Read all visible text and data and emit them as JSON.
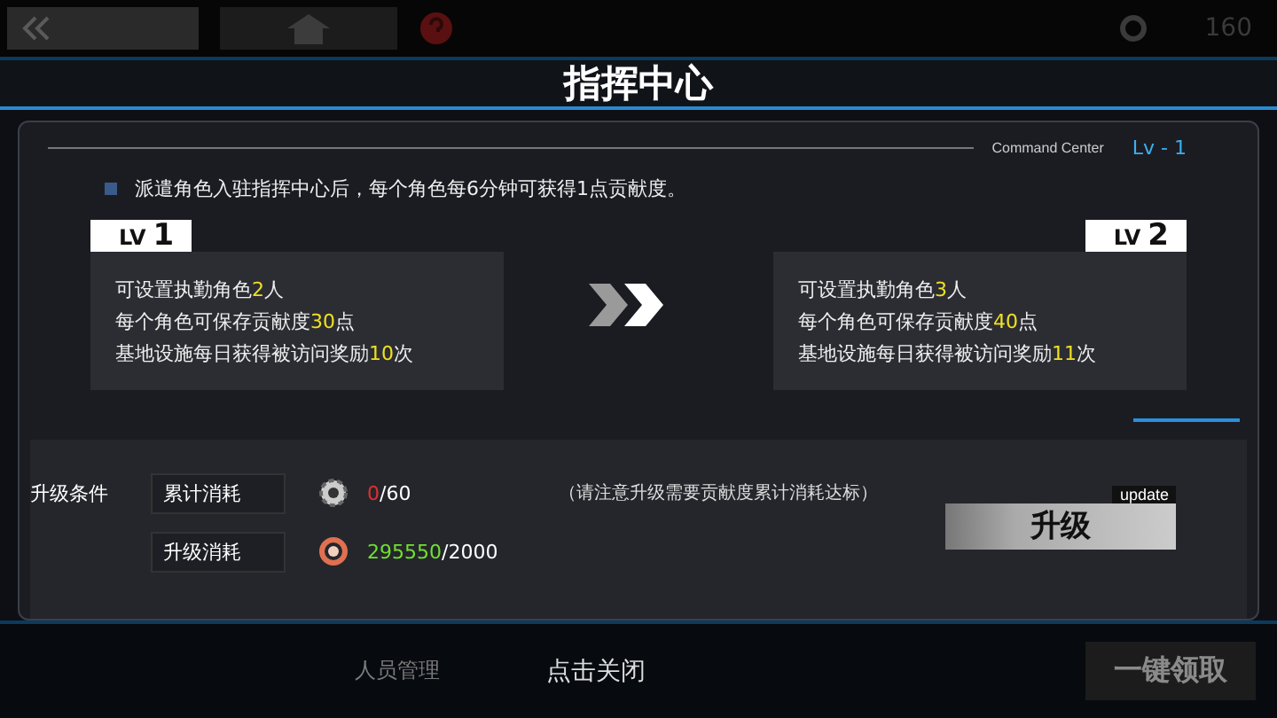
{
  "background": {
    "counter": "160",
    "tab": "人员管理",
    "claim_button": "一键领取"
  },
  "title": "指挥中心",
  "panel": {
    "subtitle": "Command Center",
    "level": "Lv - 1",
    "note": "派遣角色入驻指挥中心后，每个角色每6分钟可获得1点贡献度。",
    "cards": [
      {
        "tag": "LV",
        "level": "1",
        "lines": [
          {
            "before": "可设置执勤角色",
            "value": "2",
            "after": "人"
          },
          {
            "before": "每个角色可保存贡献度",
            "value": "30",
            "after": "点"
          },
          {
            "before": "基地设施每日获得被访问奖励",
            "value": "10",
            "after": "次"
          }
        ]
      },
      {
        "tag": "LV",
        "level": "2",
        "lines": [
          {
            "before": "可设置执勤角色",
            "value": "3",
            "after": "人"
          },
          {
            "before": "每个角色可保存贡献度",
            "value": "40",
            "after": "点"
          },
          {
            "before": "基地设施每日获得被访问奖励",
            "value": "11",
            "after": "次"
          }
        ]
      }
    ],
    "conditions_label": "升级条件",
    "requirements": [
      {
        "name": "累计消耗",
        "kind": "gear",
        "current": "0",
        "total": "/60",
        "met": false,
        "note": "（请注意升级需要贡献度累计消耗达标）"
      },
      {
        "name": "升级消耗",
        "kind": "ring",
        "current": "295550",
        "total": "/2000",
        "met": true
      }
    ],
    "upgrade_button": {
      "label": "升级",
      "tag": "update"
    }
  },
  "close_hint": "点击关闭"
}
